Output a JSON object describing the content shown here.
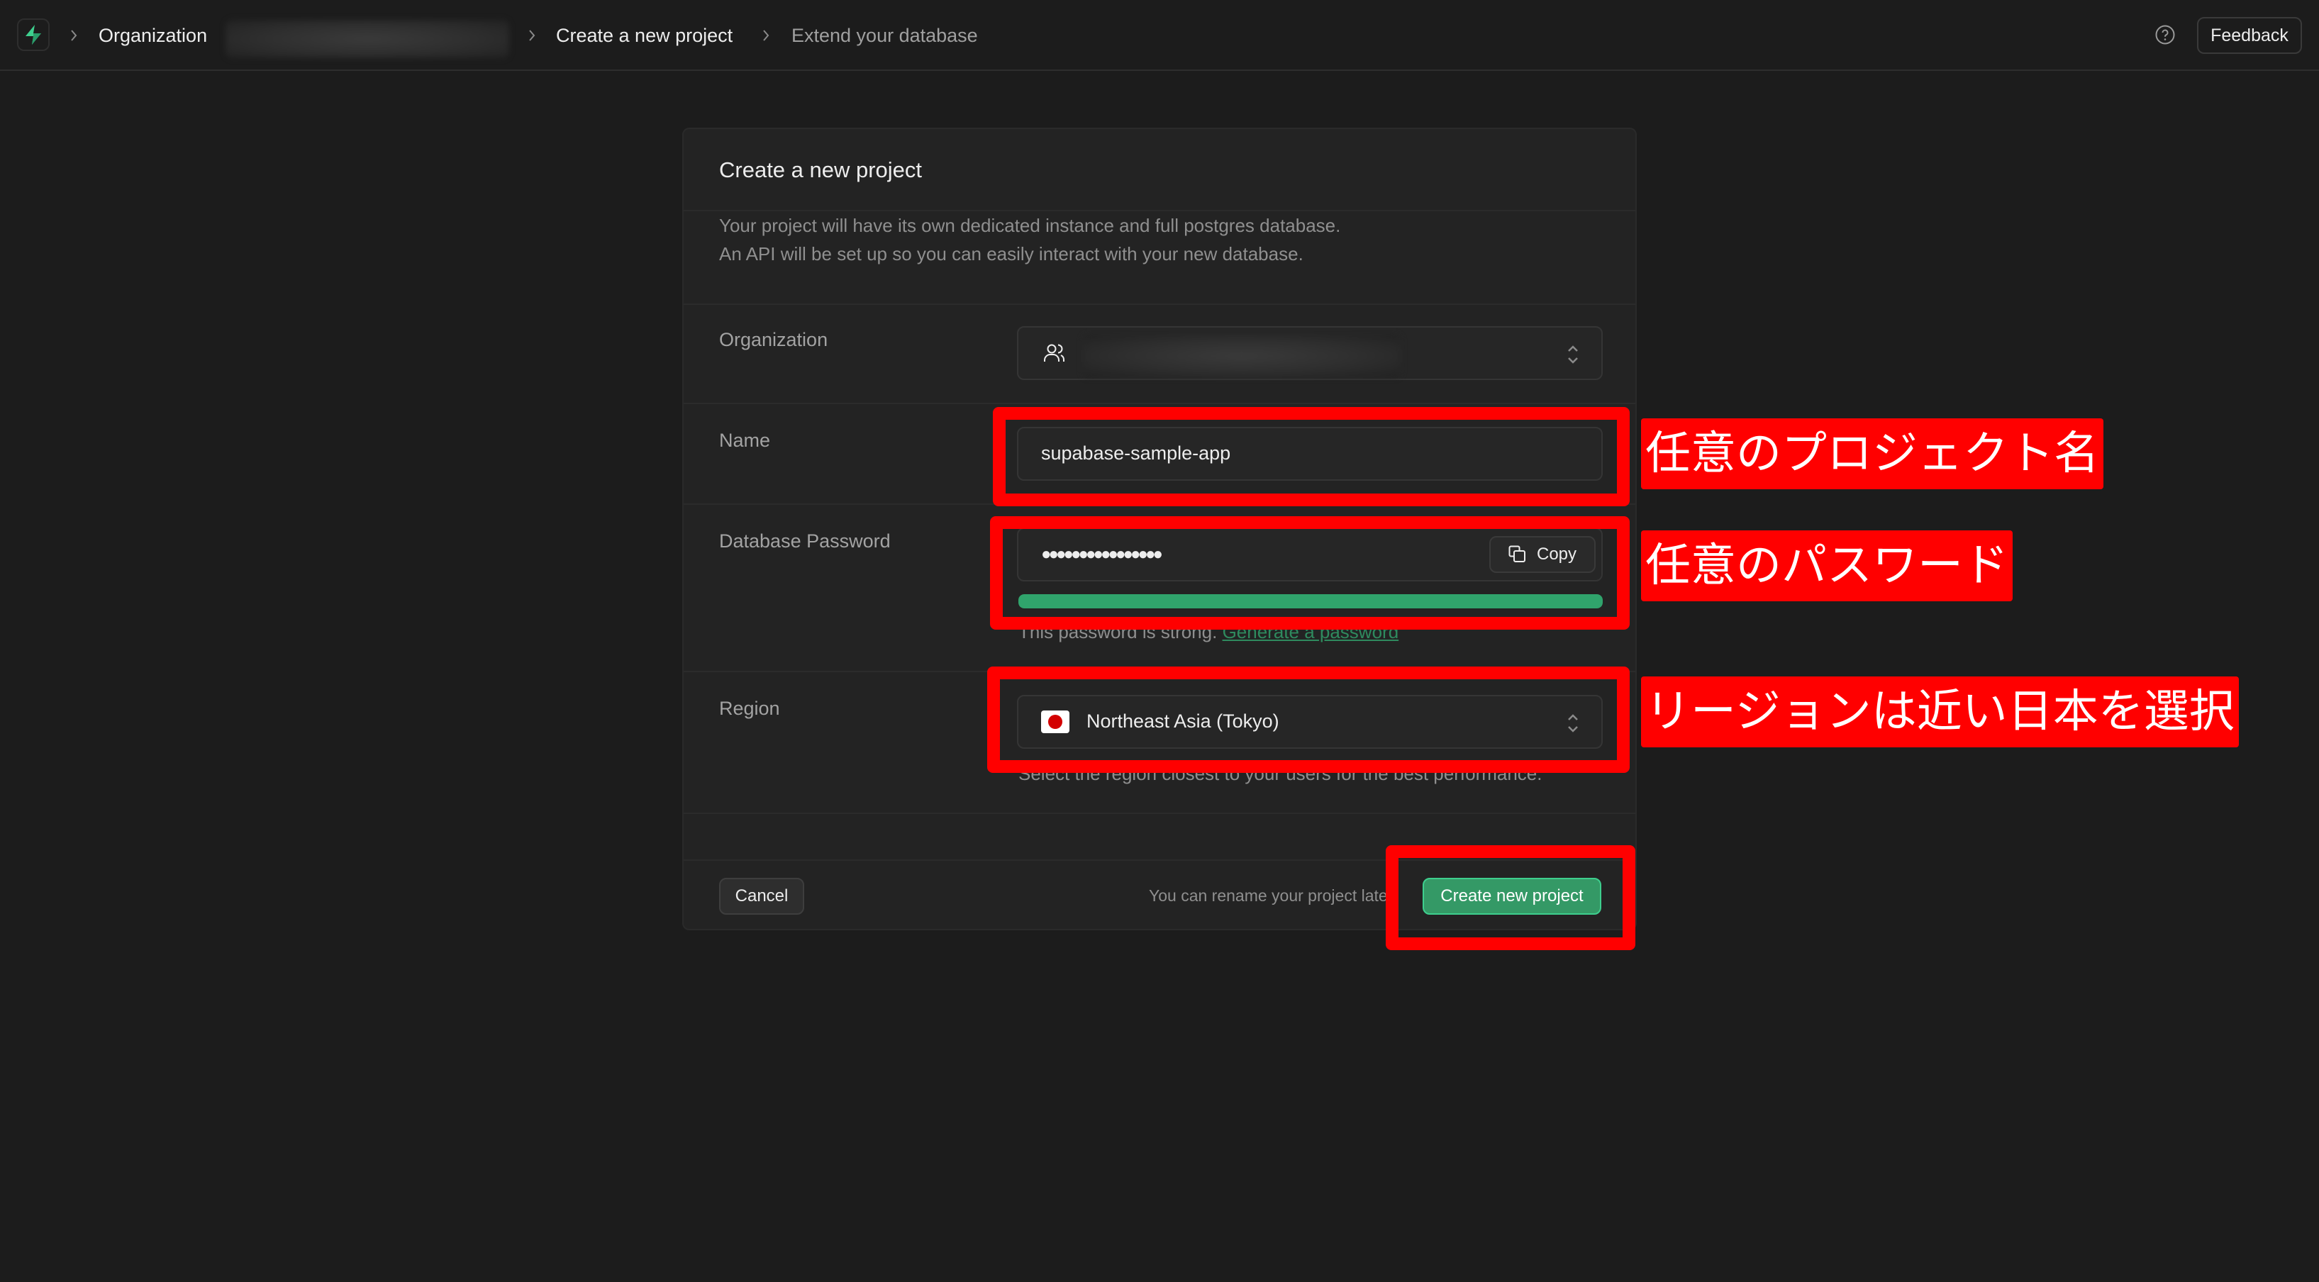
{
  "topbar": {
    "breadcrumbs": [
      {
        "label": "Organization"
      },
      {
        "label": "Create a new project"
      },
      {
        "label": "Extend your database"
      }
    ],
    "help_icon": "help-circle-icon",
    "feedback_label": "Feedback"
  },
  "card": {
    "title": "Create a new project",
    "description_line1": "Your project will have its own dedicated instance and full postgres database.",
    "description_line2": "An API will be set up so you can easily interact with your new database.",
    "fields": {
      "organization": {
        "label": "Organization",
        "icon": "users-icon",
        "value_redacted": true
      },
      "name": {
        "label": "Name",
        "value": "supabase-sample-app"
      },
      "password": {
        "label": "Database Password",
        "value_masked": "●●●●●●●●●●●●●●●●",
        "copy_label": "Copy",
        "strength_percent": 100,
        "strength_color": "#30a46c",
        "helper_text": "This password is strong.",
        "generate_link": "Generate a password"
      },
      "region": {
        "label": "Region",
        "value": "Northeast Asia (Tokyo)",
        "flag": "japan-flag",
        "helper_text": "Select the region closest to your users for the best performance."
      }
    },
    "footer": {
      "cancel_label": "Cancel",
      "note": "You can rename your project later",
      "create_label": "Create new project"
    }
  },
  "annotations": [
    {
      "text": "任意のプロジェクト名"
    },
    {
      "text": "任意のパスワード"
    },
    {
      "text": "リージョンは近い日本を選択"
    }
  ],
  "colors": {
    "accent": "#3ecf8e",
    "annotation": "#ff0000",
    "background": "#1c1c1c"
  }
}
